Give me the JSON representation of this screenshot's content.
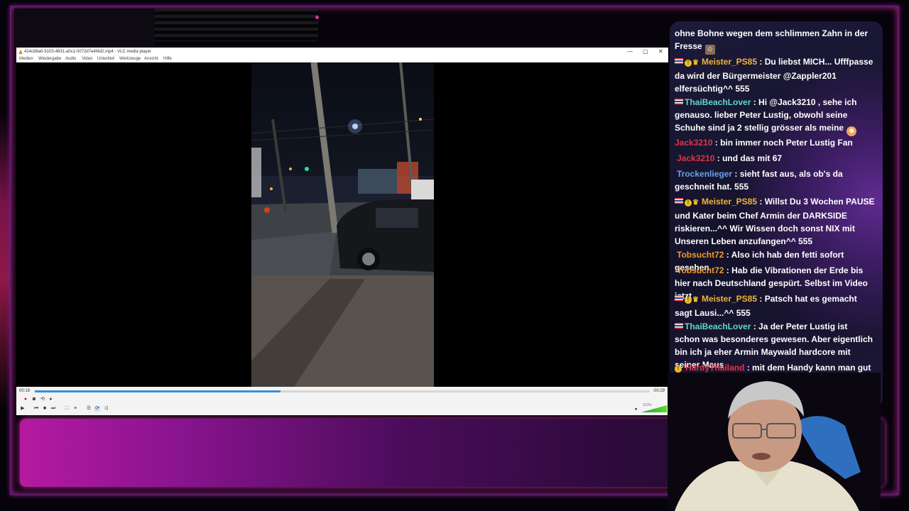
{
  "vlc": {
    "title": "414c88a0-5103-4631-a0c1-0072d7e4f4d2.mp4 - VLC media player",
    "window_controls": {
      "minimize": "—",
      "maximize": "▢",
      "close": "✕"
    },
    "menu": [
      "Medien",
      "Wiedergabe",
      "Audio",
      "Video",
      "Untertitel",
      "Werkzeuge",
      "Ansicht",
      "Hilfe"
    ],
    "elapsed": "00:19",
    "remaining": "-00:29",
    "progress_fraction": 0.4,
    "volume_label": "110%",
    "icons": {
      "record": "record-icon",
      "snapshot": "camera-icon",
      "loop_ab": "loop-ab-icon",
      "frame": "frame-step-icon",
      "play": "play-icon",
      "previous": "previous-icon",
      "stop": "stop-icon",
      "next": "next-icon",
      "fullscreen": "fullscreen-icon",
      "extended": "extended-settings-icon",
      "playlist": "playlist-icon",
      "loop": "loop-icon",
      "shuffle": "shuffle-icon",
      "volume": "volume-icon"
    }
  },
  "chat": {
    "colors": {
      "purple": "#b06ee0",
      "yellow": "#f0b43a",
      "teal": "#5fd9c2",
      "red": "#e03545",
      "blue": "#6aa3e8",
      "orange": "#f09a2a"
    },
    "messages": [
      {
        "user": "",
        "sep": "",
        "text": "ohne Bohne wegen dem schlimmen Zahn in der Fresse"
      },
      {
        "user": "Meister_PS85",
        "sep": " : ",
        "text": "Du liebst MICH... Ufffpasse da wird der Bürgermeister @Zappler201 elfersüchtig^^ 555"
      },
      {
        "user": "ThaiBeachLover",
        "sep": " : ",
        "text": "Hi @Jack3210 , sehe ich genauso. lieber Peter Lustig, obwohl seine Schuhe sind ja 2 stellig grösser als meine"
      },
      {
        "user": "Jack3210",
        "sep": " : ",
        "text": "bin immer noch Peter Lustig Fan"
      },
      {
        "user": "Jack3210",
        "sep": " : ",
        "text": "und das mit 67"
      },
      {
        "user": "Trockenlieger",
        "sep": " : ",
        "text": "sieht fast aus, als ob's da geschneit hat. 555"
      },
      {
        "user": "Meister_PS85",
        "sep": " : ",
        "text": "Willst Du 3 Wochen PAUSE und Kater beim Chef Armin der DARKSIDE riskieren...^^ Wir Wissen doch sonst NIX mit Unseren Leben anzufangen^^ 555"
      },
      {
        "user": "Tobsucht72",
        "sep": " : ",
        "text": "Also ich hab den fetti sofort gesehen"
      },
      {
        "user": "Tobsucht72",
        "sep": " : ",
        "text": "Hab die Vibrationen der Erde bis hier nach Deutschland gespürt. Selbst im Video jetzt"
      },
      {
        "user": "Meister_PS85",
        "sep": " : ",
        "text": "Patsch hat es gemacht sagt Lausi...^^ 555"
      },
      {
        "user": "ThaiBeachLover",
        "sep": " : ",
        "text": "Ja der Peter Lustig ist schon was besonderes gewesen. Aber eigentlich bin ich ja eher Armin Maywald hardcore mit seiner Maus"
      },
      {
        "user": "HardyThailand",
        "sep": " : ",
        "text": "mit dem Handy kann man gut ranzoomen"
      }
    ]
  }
}
